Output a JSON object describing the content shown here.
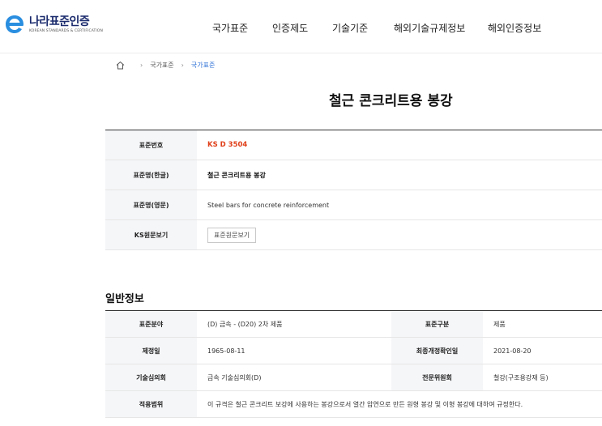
{
  "header": {
    "logo_title": "나라표준인증",
    "logo_subtitle": "KOREAN STANDARDS & CERTIFICATION",
    "nav": [
      "국가표준",
      "인증제도",
      "기술기준",
      "해외기술규제정보",
      "해외인증정보"
    ]
  },
  "breadcrumb": {
    "items": [
      "국가표준",
      "국가표준"
    ]
  },
  "page_title": "철근 콘크리트용 봉강",
  "basic": {
    "rows": [
      {
        "label": "표준번호",
        "value": "KS D 3504"
      },
      {
        "label": "표준명(한글)",
        "value": "철근 콘크리트용 봉강"
      },
      {
        "label": "표준명(영문)",
        "value": "Steel bars for concrete reinforcement"
      },
      {
        "label": "KS원문보기",
        "value": "표준원문보기"
      }
    ]
  },
  "general": {
    "title": "일반정보",
    "rows": [
      {
        "label1": "표준분야",
        "value1": "(D) 금속 - (D20) 2차 제품",
        "label2": "표준구분",
        "value2": "제품"
      },
      {
        "label1": "제정일",
        "value1": "1965-08-11",
        "label2": "최종개정확인일",
        "value2": "2021-08-20"
      },
      {
        "label1": "기술심의회",
        "value1": "금속 기술심의회(D)",
        "label2": "전문위원회",
        "value2": "철강(구조용강재 등)"
      }
    ],
    "scope_label": "적용범위",
    "scope_value": "이 규격은 철근 콘크리트 보강에 사용하는 봉강으로서 열간 압연으로 만든 원형 봉강 및 이형 봉강에 대하여 규정한다."
  },
  "colors": {
    "accent": "#2b6fd6",
    "code": "#e0401a",
    "logo": "#1a2a6c",
    "header_bg": "#f5f6f8"
  }
}
